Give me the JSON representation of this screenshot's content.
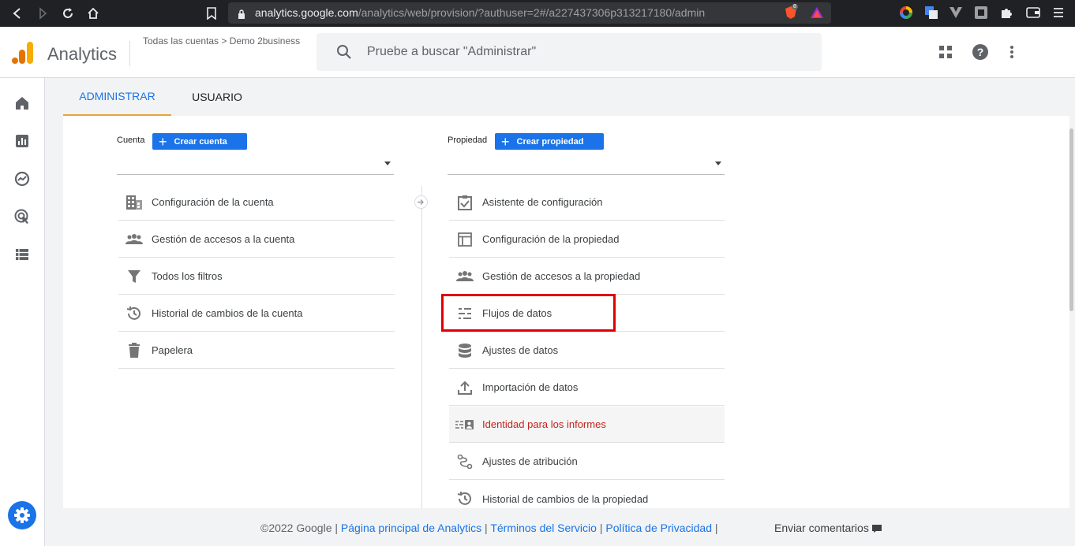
{
  "browser": {
    "url_host": "analytics.google.com",
    "url_path": "/analytics/web/provision/?authuser=2#/a227437306p313217180/admin",
    "brave_badge": "8"
  },
  "header": {
    "product_name": "Analytics",
    "breadcrumb": "Todas las cuentas > Demo 2business",
    "search_placeholder": "Pruebe a buscar \"Administrar\""
  },
  "tabs": [
    {
      "label": "ADMINISTRAR",
      "active": true
    },
    {
      "label": "USUARIO",
      "active": false
    }
  ],
  "account_column": {
    "label": "Cuenta",
    "create_label": "Crear cuenta",
    "items": [
      {
        "label": "Configuración de la cuenta",
        "icon": "building-icon"
      },
      {
        "label": "Gestión de accesos a la cuenta",
        "icon": "people-icon"
      },
      {
        "label": "Todos los filtros",
        "icon": "filter-icon"
      },
      {
        "label": "Historial de cambios de la cuenta",
        "icon": "history-icon"
      },
      {
        "label": "Papelera",
        "icon": "trash-icon"
      }
    ]
  },
  "property_column": {
    "label": "Propiedad",
    "create_label": "Crear propiedad",
    "items": [
      {
        "label": "Asistente de configuración",
        "icon": "checkbox-icon"
      },
      {
        "label": "Configuración de la propiedad",
        "icon": "layout-icon"
      },
      {
        "label": "Gestión de accesos a la propiedad",
        "icon": "people-icon"
      },
      {
        "label": "Flujos de datos",
        "icon": "data-streams-icon"
      },
      {
        "label": "Ajustes de datos",
        "icon": "database-icon"
      },
      {
        "label": "Importación de datos",
        "icon": "upload-icon"
      },
      {
        "label": "Identidad para los informes",
        "icon": "reporting-identity-icon",
        "active": true
      },
      {
        "label": "Ajustes de atribución",
        "icon": "attribution-icon"
      },
      {
        "label": "Historial de cambios de la propiedad",
        "icon": "history-icon"
      }
    ]
  },
  "footer": {
    "copyright": "©2022 Google",
    "sep": "|",
    "link_home": "Página principal de Analytics",
    "link_terms": "Términos del Servicio",
    "link_privacy": "Política de Privacidad",
    "feedback": "Enviar comentarios"
  },
  "colors": {
    "accent": "#1a73e8",
    "active_item_text": "#c5221f",
    "highlight_border": "#e00000",
    "tab_underline": "#e8a33d"
  }
}
